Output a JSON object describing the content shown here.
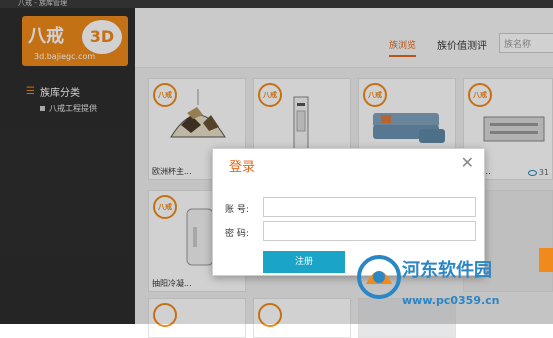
{
  "window": {
    "title_text": "八戒 - 族库管理"
  },
  "logo": {
    "brand": "八戒",
    "badge": "3D",
    "url": "3d.bajiegc.com"
  },
  "sidebar": {
    "category_title": "族库分类",
    "items": [
      {
        "label": "八戒工程提供"
      }
    ]
  },
  "topnav": {
    "active_tab": "族浏览",
    "tab2": "族价值测评",
    "search_placeholder": "族名称"
  },
  "cards": [
    {
      "badge": "八戒",
      "caption": "欧洲杯主...",
      "views": ""
    },
    {
      "badge": "八戒",
      "caption": "",
      "views": ""
    },
    {
      "badge": "八戒",
      "caption": "",
      "views": ""
    },
    {
      "badge": "八戒",
      "caption": "热水...",
      "views": "31"
    },
    {
      "badge": "八戒",
      "caption": "抽阳冷凝...",
      "views": ""
    }
  ],
  "modal": {
    "title": "登录",
    "close": "✕",
    "account_label": "账 号:",
    "password_label": "密 码:",
    "register_button": "注册"
  },
  "watermark": {
    "text": "河东软件园",
    "url": "www.pc0359.cn"
  }
}
